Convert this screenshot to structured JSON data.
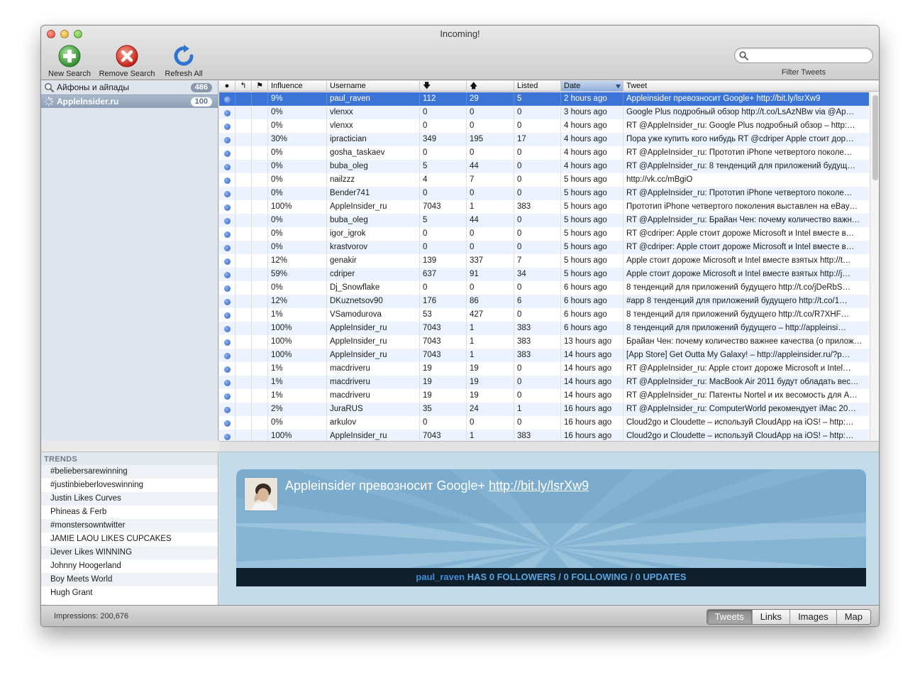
{
  "window": {
    "title": "Incoming!"
  },
  "toolbar": {
    "new_search": "New Search",
    "remove_search": "Remove Search",
    "refresh_all": "Refresh All",
    "filter_caption": "Filter Tweets",
    "filter_value": "",
    "icons": {
      "new_search": "plus-icon",
      "remove_search": "remove-x-icon",
      "refresh_all": "refresh-icon",
      "filter": "magnifier-icon"
    },
    "colors": {
      "new_search": "#3da53a",
      "remove_search": "#d93a2b",
      "refresh_all": "#3b7fd6"
    }
  },
  "sources": [
    {
      "label": "Айфоны и айпады",
      "count": "486",
      "icon": "search-icon",
      "selected": false
    },
    {
      "label": "AppleInsider.ru",
      "count": "100",
      "icon": "spinner-icon",
      "selected": true
    }
  ],
  "trends": {
    "heading": "TRENDS",
    "items": [
      "#beliebersarewinning",
      "#justinbieberloveswinning",
      "Justin Likes Curves",
      "Phineas & Ferb",
      "#monstersowntwitter",
      "JAMIE LAOU LIKES CUPCAKES",
      "iJever Likes WINNING",
      "Johnny Hoogerland",
      "Boy Meets World",
      "Hugh Grant"
    ]
  },
  "table": {
    "columns": {
      "unread": "●",
      "reply": "↰",
      "flag": "⚑",
      "influence": "Influence",
      "username": "Username",
      "followers": "🡇",
      "following": "🡅",
      "listed": "Listed",
      "date": "Date",
      "tweet": "Tweet"
    },
    "sort_column": "Date",
    "rows": [
      {
        "influence": "9%",
        "username": "paul_raven",
        "followers": "112",
        "following": "29",
        "listed": "5",
        "date": "2 hours ago",
        "tweet": "Appleinsider превозносит Google+ http://bit.ly/lsrXw9",
        "selected": true
      },
      {
        "influence": "0%",
        "username": "vlenxx",
        "followers": "0",
        "following": "0",
        "listed": "0",
        "date": "3 hours ago",
        "tweet": "Google Plus подробный обзор http://t.co/LsAzNBw via @Ap…"
      },
      {
        "influence": "0%",
        "username": "vlenxx",
        "followers": "0",
        "following": "0",
        "listed": "0",
        "date": "4 hours ago",
        "tweet": "RT @AppleInsider_ru: Google Plus подробный обзор – http:…"
      },
      {
        "influence": "30%",
        "username": "ipractician",
        "followers": "349",
        "following": "195",
        "listed": "17",
        "date": "4 hours ago",
        "tweet": "Пора уже купить кого нибудь RT @cdriper Apple стоит дор…"
      },
      {
        "influence": "0%",
        "username": "gosha_taskaev",
        "followers": "0",
        "following": "0",
        "listed": "0",
        "date": "4 hours ago",
        "tweet": "RT @AppleInsider_ru: Прототип  iPhone четвертого поколе…"
      },
      {
        "influence": "0%",
        "username": "buba_oleg",
        "followers": "5",
        "following": "44",
        "listed": "0",
        "date": "4 hours ago",
        "tweet": "RT @AppleInsider_ru: 8 тенденций для приложений будущ…"
      },
      {
        "influence": "0%",
        "username": "nailzzz",
        "followers": "4",
        "following": "7",
        "listed": "0",
        "date": "5 hours ago",
        "tweet": "http://vk.cc/mBgiO"
      },
      {
        "influence": "0%",
        "username": "Bender741",
        "followers": "0",
        "following": "0",
        "listed": "0",
        "date": "5 hours ago",
        "tweet": "RT @AppleInsider_ru: Прототип  iPhone четвертого поколе…"
      },
      {
        "influence": "100%",
        "username": "AppleInsider_ru",
        "followers": "7043",
        "following": "1",
        "listed": "383",
        "date": "5 hours ago",
        "tweet": "Прототип  iPhone четвертого поколения выставлен на eBay…"
      },
      {
        "influence": "0%",
        "username": "buba_oleg",
        "followers": "5",
        "following": "44",
        "listed": "0",
        "date": "5 hours ago",
        "tweet": "RT @AppleInsider_ru: Брайан Чен: почему количество важн…"
      },
      {
        "influence": "0%",
        "username": "igor_igrok",
        "followers": "0",
        "following": "0",
        "listed": "0",
        "date": "5 hours ago",
        "tweet": "RT @cdriper: Apple стоит дороже Microsoft и Intel вместе в…"
      },
      {
        "influence": "0%",
        "username": "krastvorov",
        "followers": "0",
        "following": "0",
        "listed": "0",
        "date": "5 hours ago",
        "tweet": "RT @cdriper: Apple стоит дороже Microsoft и Intel вместе в…"
      },
      {
        "influence": "12%",
        "username": "genakir",
        "followers": "139",
        "following": "337",
        "listed": "7",
        "date": "5 hours ago",
        "tweet": "Apple стоит дороже Microsoft и Intel вместе взятых http://t…"
      },
      {
        "influence": "59%",
        "username": "cdriper",
        "followers": "637",
        "following": "91",
        "listed": "34",
        "date": "5 hours ago",
        "tweet": "Apple стоит дороже Microsoft и Intel вместе взятых http://j…"
      },
      {
        "influence": "0%",
        "username": "Dj_Snowflake",
        "followers": "0",
        "following": "0",
        "listed": "0",
        "date": "6 hours ago",
        "tweet": "8 тенденций для приложений будущего http://t.co/jDeRbS…"
      },
      {
        "influence": "12%",
        "username": "DKuznetsov90",
        "followers": "176",
        "following": "86",
        "listed": "6",
        "date": "6 hours ago",
        "tweet": "#app 8 тенденций для приложений будущего http://t.co/1…"
      },
      {
        "influence": "1%",
        "username": "VSamodurova",
        "followers": "53",
        "following": "427",
        "listed": "0",
        "date": "6 hours ago",
        "tweet": "8 тенденций для приложений будущего http://t.co/R7XHF…"
      },
      {
        "influence": "100%",
        "username": "AppleInsider_ru",
        "followers": "7043",
        "following": "1",
        "listed": "383",
        "date": "6 hours ago",
        "tweet": "8 тенденций для приложений будущего – http://appleinsi…"
      },
      {
        "influence": "100%",
        "username": "AppleInsider_ru",
        "followers": "7043",
        "following": "1",
        "listed": "383",
        "date": "13 hours ago",
        "tweet": "Брайан Чен: почему количество важнее качества (о прилож…"
      },
      {
        "influence": "100%",
        "username": "AppleInsider_ru",
        "followers": "7043",
        "following": "1",
        "listed": "383",
        "date": "14 hours ago",
        "tweet": "[App Store] Get Outta My Galaxy! – http://appleinsider.ru/?p…"
      },
      {
        "influence": "1%",
        "username": "macdriveru",
        "followers": "19",
        "following": "19",
        "listed": "0",
        "date": "14 hours ago",
        "tweet": "RT @AppleInsider_ru: Apple стоит дороже Microsoft и Intel…"
      },
      {
        "influence": "1%",
        "username": "macdriveru",
        "followers": "19",
        "following": "19",
        "listed": "0",
        "date": "14 hours ago",
        "tweet": "RT @AppleInsider_ru: MacBook Air 2011 будут обладать вес…"
      },
      {
        "influence": "1%",
        "username": "macdriveru",
        "followers": "19",
        "following": "19",
        "listed": "0",
        "date": "14 hours ago",
        "tweet": "RT @AppleInsider_ru: Патенты Nortel и их весомость для А…"
      },
      {
        "influence": "2%",
        "username": "JuraRUS",
        "followers": "35",
        "following": "24",
        "listed": "1",
        "date": "16 hours ago",
        "tweet": "RT @AppleInsider_ru: ComputerWorld рекомендует iMac 20…"
      },
      {
        "influence": "0%",
        "username": "arkulov",
        "followers": "0",
        "following": "0",
        "listed": "0",
        "date": "16 hours ago",
        "tweet": "Cloud2go и Cloudette – используй CloudApp на iOS! – http:…"
      },
      {
        "influence": "100%",
        "username": "AppleInsider_ru",
        "followers": "7043",
        "following": "1",
        "listed": "383",
        "date": "16 hours ago",
        "tweet": "Cloud2go и Cloudette – используй CloudApp на iOS! – http:…"
      }
    ]
  },
  "detail": {
    "tweet_prefix": "Appleinsider превозносит Google+ ",
    "tweet_link": "http://bit.ly/lsrXw9",
    "username": "paul_raven",
    "stats": " HAS 0 FOLLOWERS / 0 FOLLOWING / 0 UPDATES",
    "avatar_icon": "user-avatar"
  },
  "status": {
    "impressions": "Impressions: 200,676",
    "tabs": [
      "Tweets",
      "Links",
      "Images",
      "Map"
    ],
    "active_tab": "Tweets"
  }
}
